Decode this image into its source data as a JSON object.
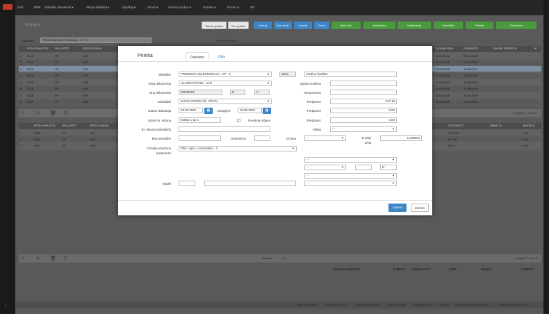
{
  "app": {
    "logo_text": "AMC",
    "nav": [
      "RMK",
      "Skladišni dokumenti ▾",
      "Stanje skladišta ▾",
      "Izvještaji ▾",
      "Servis ▾",
      "Osnovni podaci ▾",
      "Postava ▾",
      "Pomoć ▾",
      "SR"
    ]
  },
  "page": {
    "title": "Primka",
    "top_buttons": [
      "Tekuća godina",
      "Sve godine"
    ],
    "action_buttons": [
      "Kreiraj",
      "Sve Cede",
      "Kopiraj",
      "Nova",
      "BarCode",
      "Nabavnica",
      "Deklaracija",
      "Naručitke",
      "Primka",
      "Dokument"
    ],
    "filter_label": "Skladište",
    "filter_value": "PROMONA VELEPRODAJA - VP - V",
    "filter_right": "VELEPRODAJA"
  },
  "grid1": {
    "headers": [
      "POSLOVNA GOD",
      "SKLADIŠTE",
      "VRSTA DOKUM",
      "DATUM IZDAV",
      "DOSPIJEĆE",
      "ZAVISNI TROŠKOVI",
      "IK"
    ],
    "rows": [
      {
        "n": "2",
        "year": "2018",
        "sk": "VP",
        "vd": "ULR",
        "d1": "10.07.2018",
        "d2": "10.07.2018"
      },
      {
        "n": "2",
        "year": "2018",
        "sk": "VP",
        "vd": "ULR",
        "d1": "05.07.2018",
        "d2": "07.07.2018"
      },
      {
        "n": "3",
        "year": "2018",
        "sk": "VP",
        "vd": "ULR",
        "d1": "28.06.2018",
        "d2": "28.06.2018"
      },
      {
        "n": "4",
        "year": "2018",
        "sk": "VP",
        "vd": "ULR",
        "d1": "20.06.2018",
        "d2": "20.06.2018"
      },
      {
        "n": "5",
        "year": "2018",
        "sk": "VP",
        "vd": "ULR",
        "d1": "11.06.2018",
        "d2": "19.06.2018"
      },
      {
        "n": "6",
        "year": "2018",
        "sk": "VP",
        "vd": "ULR",
        "d1": "24.05.2018",
        "d2": "01.06.2018"
      },
      {
        "n": "7",
        "year": "2018",
        "sk": "VP",
        "vd": "ULR",
        "d1": "16.04.2018",
        "d2": "16.04.2018"
      },
      {
        "n": "8",
        "year": "2018",
        "sk": "VP",
        "vd": "ULR",
        "d1": "06.04.2018",
        "d2": "27.04.2018"
      }
    ],
    "pager": "Pregled 1 - 8 od 11"
  },
  "grid2": {
    "headers": [
      "POSLOVNA GOD",
      "SKLADIŠTE",
      "VRSTA DOKUM",
      "VPC/DNOST",
      "RABAT %",
      "MARŽA %"
    ],
    "rows": [
      {
        "n": "1",
        "year": "2018",
        "sk": "VP",
        "vd": "ULR",
        "v": "1.700,00",
        "r": "",
        "m": "0,00"
      },
      {
        "n": "2",
        "year": "2018",
        "sk": "VP",
        "vd": "ULR",
        "v": "601,88",
        "r": "",
        "m": "0,00"
      },
      {
        "n": "3",
        "year": "2018",
        "sk": "VP",
        "vd": "ULR",
        "v": "66,75",
        "r": "",
        "m": "0,00"
      }
    ],
    "pager": "Pregled 1 - 3 od 3",
    "page_label": "Stranica",
    "page_of": "od 1"
  },
  "totals": {
    "nab_label": "Nabavna vrijednost:",
    "nab_value": "2.468,73",
    "ulaz_label": "Ukupan porez:",
    "ulaz_value": "75,00",
    "uk_label": "Ukupno:",
    "uk_value": "2.468,73"
  },
  "status": [
    "Dettina Čamber",
    "PROMONA D.O.O.",
    "Novi: Administrator",
    "Kosi: Promona",
    "Blagajna: PRO",
    "Kasa: 10",
    "Obračunska godina: 00001",
    "Poslovna godina: 2018"
  ],
  "modal": {
    "title": "Primka",
    "tabs": [
      "Osnovno",
      "Opis"
    ],
    "skladiste_label": "Skladište",
    "skladiste_value": "PROMONA VELEPRODAJA - VP - V",
    "year_value": "2018",
    "user_value": "Dettina Čamber",
    "vrsta_label": "Vrsta dokumenta",
    "vrsta_value": "ULAZNI RAČUN - ULR",
    "zavisni_label": "Zavisni troškovi",
    "broj_label": "Broj dokumenta",
    "broj_value": "00000013",
    "broj_k": "K",
    "broj_u": "U",
    "neoporezivo_label": "Neoporezivo",
    "dobavljac_label": "Dobavljač",
    "dobavljac_value": "M.SAN GRUPA dd - MSAN",
    "predporez_label": "Predporez",
    "predporez_value1": "617,19",
    "datum_label": "Datum izdavanja",
    "datum_value": "28.06.2018",
    "dospijece_label": "Dospijeće",
    "dospijece_value": "28.06.2018",
    "predporez_value2": "0,00",
    "ulazni_label": "Ulazni br. računa",
    "ulazni_value": "82931-1-11-1",
    "posebna_label": "Posebna rabava",
    "predporez_value3": "0,00",
    "br_dobavljaca_label": "Br. računa dobavljača",
    "valuta_label": "Valuta",
    "valuta_value": "- -",
    "narudzbe_label": "Broj narudžbe",
    "dostavnica_label": "Dostavnica",
    "drzava_label": "Država",
    "drzava_value": "- -",
    "srednji_label": "Srednji",
    "tecaj_label": "tečaj",
    "tecaj_value": "1,000000",
    "oznaka_label": "Oznaka obračuna",
    "oznaka_label2": "pretporeza",
    "oznaka_value": "Prim. ispor. u tuzemstvu - 1",
    "dd1": "- -",
    "dd2": "- -",
    "dd3": "N",
    "dd4": "- -",
    "dd5": "- -",
    "model_label": "Model",
    "save_label": "Spremi",
    "close_label": "Zatvori",
    "calendar_icon": "calendar-icon"
  }
}
